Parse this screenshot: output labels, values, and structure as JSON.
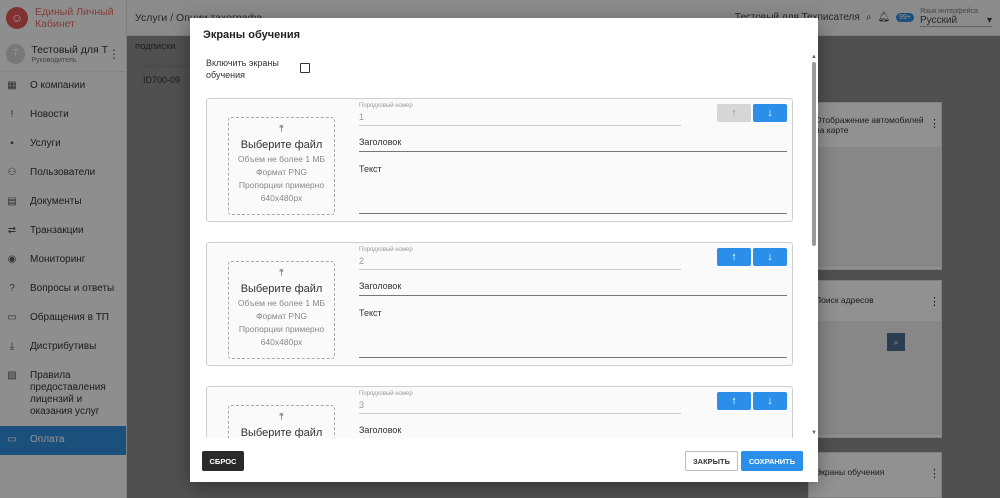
{
  "brand": {
    "logo_letter": "☺",
    "title_line1": "Единый Личный",
    "title_line2": "Кабинет"
  },
  "user": {
    "avatar_letter": "Т",
    "name": "Тестовый для Т",
    "role": "Руководитель",
    "menu": "⋮"
  },
  "sidebar": {
    "items": [
      {
        "icon": "▦",
        "label": "О компании"
      },
      {
        "icon": "!",
        "label": "Новости"
      },
      {
        "icon": "▪",
        "label": "Услуги"
      },
      {
        "icon": "⚇",
        "label": "Пользователи"
      },
      {
        "icon": "▤",
        "label": "Документы"
      },
      {
        "icon": "⇄",
        "label": "Транзакции"
      },
      {
        "icon": "◉",
        "label": "Мониторинг"
      },
      {
        "icon": "?",
        "label": "Вопросы и ответы"
      },
      {
        "icon": "▭",
        "label": "Обращения в ТП"
      },
      {
        "icon": "⤓",
        "label": "Дистрибутивы"
      },
      {
        "icon": "▨",
        "label": "Правила предоставления лицензий и оказания услуг"
      },
      {
        "icon": "▭",
        "label": "Оплата"
      }
    ]
  },
  "topbar": {
    "breadcrumb": "Услуги  /  Опции тахографа",
    "user_label": "Тестовый для Техписателя",
    "notif_badge": "99+",
    "lang_label": "Язык интерфейса",
    "lang_value": "Русский"
  },
  "background": {
    "subscriptions": "подписки",
    "device_label": "Выбор компании",
    "device_value": "ID700-09",
    "card1": "Отображение автомобилей на карте",
    "card2": "Поиск адресов",
    "card3": "Экраны обучения"
  },
  "modal": {
    "title": "Экраны обучения",
    "enable_label": "Включить экраны обучения",
    "enable_checked": false,
    "uploader": {
      "icon": "⤒",
      "title": "Выберите файл",
      "size": "Объем не более 1 МБ",
      "format": "Формат PNG",
      "ratio": "Пропорции примерно",
      "dims": "640x480px"
    },
    "order_label": "Порядковый номер",
    "title_label": "Заголовок",
    "text_label": "Текст",
    "arrow_up": "↑",
    "arrow_down": "↓",
    "screens": [
      {
        "order": "1"
      },
      {
        "order": "2"
      },
      {
        "order": "3"
      }
    ],
    "reset_label": "СБРОС",
    "close_label": "ЗАКРЫТЬ",
    "save_label": "СОХРАНИТЬ"
  },
  "colors": {
    "accent": "#2b8ee8",
    "brand_red": "#e05555",
    "active_nav": "#2f8bd6"
  }
}
